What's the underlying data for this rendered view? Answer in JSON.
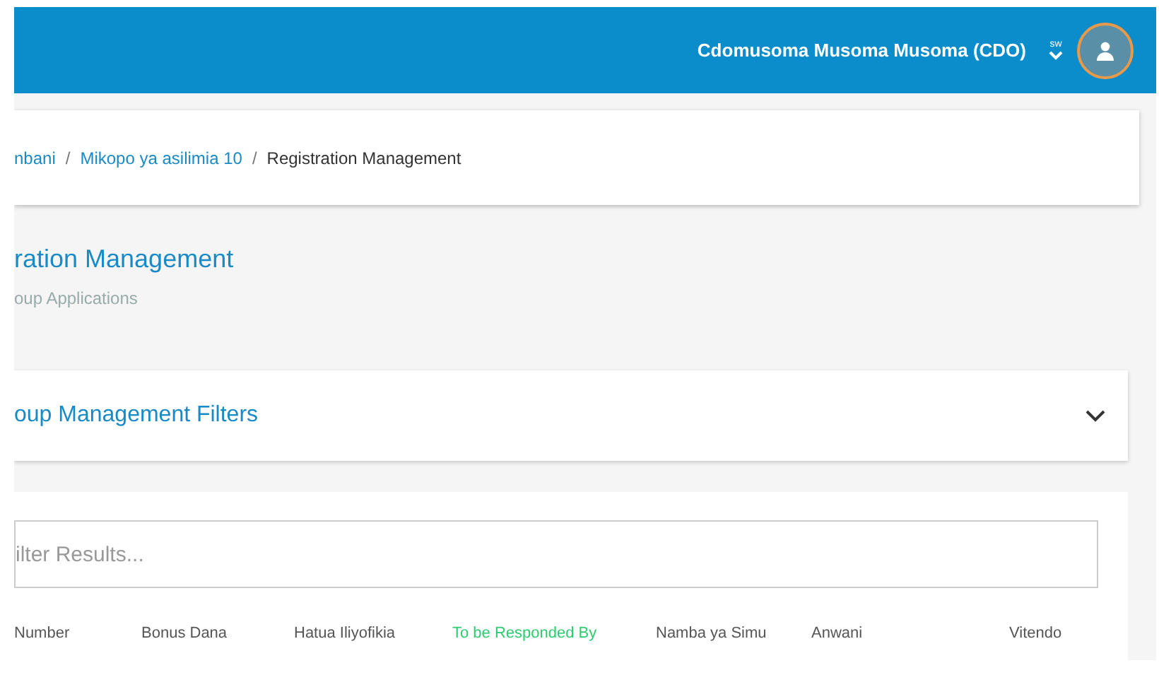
{
  "header": {
    "user_name": "Cdomusoma Musoma Musoma (CDO)",
    "switch_label": "sw"
  },
  "breadcrumb": [
    {
      "label": "nbani",
      "link": true
    },
    {
      "separator": "/"
    },
    {
      "label": "Mikopo ya asilimia 10",
      "link": true
    },
    {
      "separator": "/"
    },
    {
      "label": "Registration Management",
      "link": false
    }
  ],
  "page": {
    "title": "ration Management",
    "subtitle": "oup Applications"
  },
  "filters_panel": {
    "title": "oup Management Filters",
    "expanded": false
  },
  "table": {
    "search": {
      "placeholder": "ilter Results..."
    },
    "columns": [
      {
        "label": "Number",
        "highlight": false
      },
      {
        "label": "Bonus Dana",
        "highlight": false
      },
      {
        "label": "Hatua Iliyofikia",
        "highlight": false
      },
      {
        "label": "To be Responded By",
        "highlight": true
      },
      {
        "label": "Namba ya Simu",
        "highlight": false
      },
      {
        "label": "Anwani",
        "highlight": false
      },
      {
        "label": "Vitendo",
        "highlight": false
      }
    ]
  }
}
